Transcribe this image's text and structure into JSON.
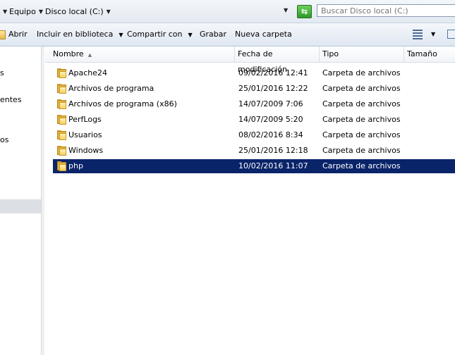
{
  "address": {
    "crumbs": [
      "Equipo",
      "Disco local (C:)"
    ],
    "search_placeholder": "Buscar Disco local (C:)"
  },
  "toolbar": {
    "open_label": "Abrir",
    "library_label": "Incluir en biblioteca",
    "share_label": "Compartir con",
    "burn_label": "Grabar",
    "new_folder_label": "Nueva carpeta"
  },
  "nav": {
    "items": [
      "s",
      "entes",
      "os"
    ]
  },
  "columns": {
    "name": "Nombre",
    "modified": "Fecha de modificación",
    "type": "Tipo",
    "size": "Tamaño"
  },
  "files": [
    {
      "name": "Apache24",
      "modified": "09/02/2016 12:41",
      "type": "Carpeta de archivos"
    },
    {
      "name": "Archivos de programa",
      "modified": "25/01/2016 12:22",
      "type": "Carpeta de archivos"
    },
    {
      "name": "Archivos de programa (x86)",
      "modified": "14/07/2009 7:06",
      "type": "Carpeta de archivos"
    },
    {
      "name": "PerfLogs",
      "modified": "14/07/2009 5:20",
      "type": "Carpeta de archivos"
    },
    {
      "name": "Usuarios",
      "modified": "08/02/2016 8:34",
      "type": "Carpeta de archivos"
    },
    {
      "name": "Windows",
      "modified": "25/01/2016 12:18",
      "type": "Carpeta de archivos"
    },
    {
      "name": "php",
      "modified": "10/02/2016 11:07",
      "type": "Carpeta de archivos"
    }
  ],
  "selected_file": "php",
  "colors": {
    "selection": "#0a246a",
    "folder": "#e3b23c"
  }
}
